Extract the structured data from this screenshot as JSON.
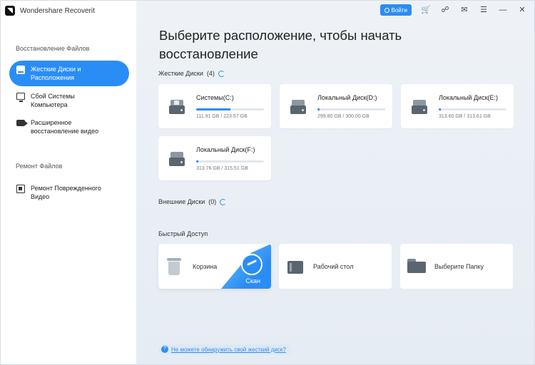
{
  "app": {
    "title": "Wondershare Recoverit"
  },
  "topbar": {
    "login_label": "Войти",
    "icons": [
      "cart-icon",
      "headset-icon",
      "mail-icon",
      "settings-icon",
      "minimize-icon",
      "close-icon"
    ]
  },
  "sidebar": {
    "section_recovery": "Восстановление Файлов",
    "items": [
      {
        "label_line1": "Жесткие Диски и",
        "label_line2": "Расположения",
        "icon": "hard-drive-icon",
        "active": true
      },
      {
        "label_line1": "Сбой Системы",
        "label_line2": "Компьютера",
        "icon": "computer-icon",
        "active": false
      },
      {
        "label_line1": "Расширенное",
        "label_line2": "восстановление видео",
        "icon": "video-camera-icon",
        "active": false
      }
    ],
    "section_repair": "Ремонт Файлов",
    "repair_items": [
      {
        "label_line1": "Ремонт Поврежденного",
        "label_line2": "Видео",
        "icon": "repair-video-icon"
      }
    ]
  },
  "main": {
    "headline_line1": "Выберите расположение, чтобы начать",
    "headline_line2": "восстановление",
    "hard_drives": {
      "label": "Жесткие Диски",
      "count": "(4)",
      "drives": [
        {
          "name": "Системы(C:)",
          "size": "111.91 GB / 223.57 GB",
          "used_fraction": 0.5
        },
        {
          "name": "Локальный Диск(D:)",
          "size": "299.80 GB / 300.00 GB",
          "used_fraction": 0.03
        },
        {
          "name": "Локальный Диск(E:)",
          "size": "313.60 GB / 313.61 GB",
          "used_fraction": 0.03
        },
        {
          "name": "Локальный Диск(F:)",
          "size": "313.76 GB / 315.51 GB",
          "used_fraction": 0.03
        }
      ]
    },
    "external_drives": {
      "label": "Внешние Диски",
      "count": "(0)"
    },
    "quick_access": {
      "label": "Быстрый Доступ",
      "items": [
        {
          "label": "Корзина",
          "icon": "trash-icon"
        },
        {
          "label": "Рабочий стол",
          "icon": "desktop-icon"
        },
        {
          "label": "Выберите Папку",
          "icon": "folder-icon"
        }
      ],
      "scan_label": "Скан"
    },
    "help_link": "Не можете обнаружить свой жесткий диск?"
  }
}
